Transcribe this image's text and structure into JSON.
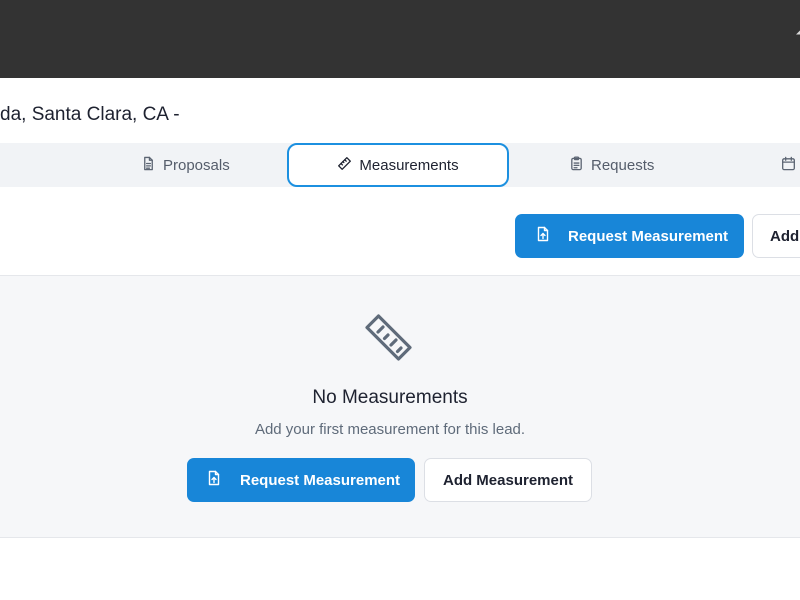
{
  "address": "da, Santa Clara, CA -",
  "tabs": {
    "proposals": "Proposals",
    "measurements": "Measurements",
    "requests": "Requests",
    "calendar": ""
  },
  "actions": {
    "request_measurement": "Request Measurement",
    "add_truncated": "Add"
  },
  "empty_state": {
    "title": "No Measurements",
    "subtitle": "Add your first measurement for this lead.",
    "request_label": "Request Measurement",
    "add_label": "Add Measurement"
  },
  "colors": {
    "topbar": "#333333",
    "primary": "#1886d8",
    "active_tab_border": "#1c90e0",
    "muted_text": "#5f6b7a"
  }
}
